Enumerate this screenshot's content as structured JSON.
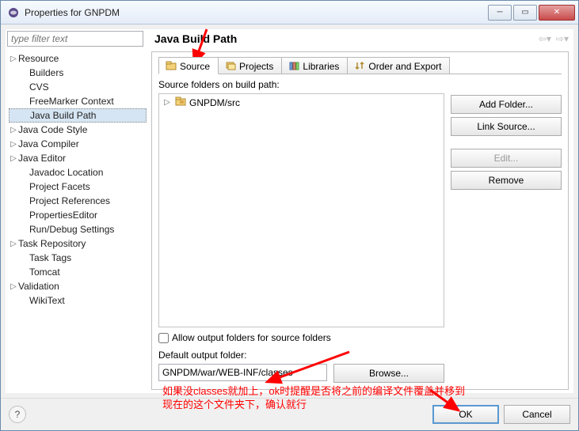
{
  "window": {
    "title": "Properties for GNPDM"
  },
  "filter": {
    "placeholder": "type filter text"
  },
  "tree": [
    {
      "label": "Resource",
      "expandable": true,
      "indent": 0
    },
    {
      "label": "Builders",
      "expandable": false,
      "indent": 1
    },
    {
      "label": "CVS",
      "expandable": false,
      "indent": 1
    },
    {
      "label": "FreeMarker Context",
      "expandable": false,
      "indent": 1
    },
    {
      "label": "Java Build Path",
      "expandable": false,
      "indent": 1,
      "selected": true
    },
    {
      "label": "Java Code Style",
      "expandable": true,
      "indent": 0
    },
    {
      "label": "Java Compiler",
      "expandable": true,
      "indent": 0
    },
    {
      "label": "Java Editor",
      "expandable": true,
      "indent": 0
    },
    {
      "label": "Javadoc Location",
      "expandable": false,
      "indent": 1
    },
    {
      "label": "Project Facets",
      "expandable": false,
      "indent": 1
    },
    {
      "label": "Project References",
      "expandable": false,
      "indent": 1
    },
    {
      "label": "PropertiesEditor",
      "expandable": false,
      "indent": 1
    },
    {
      "label": "Run/Debug Settings",
      "expandable": false,
      "indent": 1
    },
    {
      "label": "Task Repository",
      "expandable": true,
      "indent": 0
    },
    {
      "label": "Task Tags",
      "expandable": false,
      "indent": 1
    },
    {
      "label": "Tomcat",
      "expandable": false,
      "indent": 1
    },
    {
      "label": "Validation",
      "expandable": true,
      "indent": 0
    },
    {
      "label": "WikiText",
      "expandable": false,
      "indent": 1
    }
  ],
  "page": {
    "title": "Java Build Path"
  },
  "tabs": [
    {
      "label": "Source",
      "icon": "package-icon"
    },
    {
      "label": "Projects",
      "icon": "folders-icon"
    },
    {
      "label": "Libraries",
      "icon": "books-icon"
    },
    {
      "label": "Order and Export",
      "icon": "order-icon"
    }
  ],
  "source": {
    "list_label": "Source folders on build path:",
    "items": [
      {
        "label": "GNPDM/src"
      }
    ],
    "buttons": {
      "add_folder": "Add Folder...",
      "link_source": "Link Source...",
      "edit": "Edit...",
      "remove": "Remove"
    },
    "allow_output_checkbox": "Allow output folders for source folders",
    "allow_output_checked": false,
    "default_output_label": "Default output folder:",
    "default_output_value": "GNPDM/war/WEB-INF/classes",
    "browse": "Browse..."
  },
  "buttons": {
    "ok": "OK",
    "cancel": "Cancel"
  },
  "annotation": {
    "text1": "如果没classes就加上，ok时提醒是否将之前的编译文件覆盖并移到",
    "text2": "现在的这个文件夹下，确认就行"
  }
}
